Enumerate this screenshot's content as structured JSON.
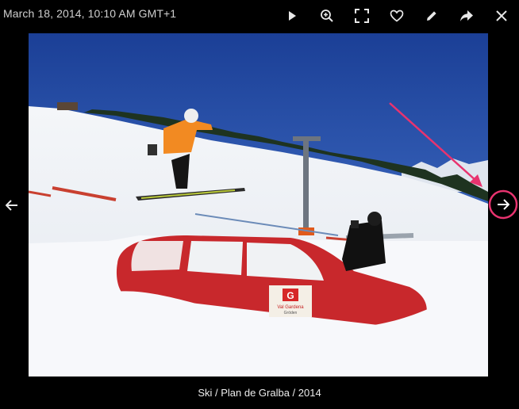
{
  "header": {
    "timestamp": "March 18, 2014, 10:10 AM GMT+1"
  },
  "toolbar": {
    "items": [
      {
        "name": "play",
        "icon": "play-icon"
      },
      {
        "name": "zoom",
        "icon": "zoom-in-icon"
      },
      {
        "name": "fullscreen",
        "icon": "fullscreen-icon"
      },
      {
        "name": "favorite",
        "icon": "heart-icon"
      },
      {
        "name": "edit",
        "icon": "pencil-icon"
      },
      {
        "name": "share",
        "icon": "share-arrow-icon"
      },
      {
        "name": "close",
        "icon": "close-icon"
      }
    ]
  },
  "photo": {
    "caption": "Ski / Plan de Gralba / 2014",
    "sign_logo": "G",
    "sign_text_1": "Val Gardena",
    "sign_text_2": "Gröden"
  },
  "navigation": {
    "prev_icon": "arrow-left-icon",
    "next_icon": "arrow-right-icon"
  },
  "colors": {
    "background": "#000000",
    "highlight": "#e8336f",
    "icon": "#e8e8e8"
  }
}
